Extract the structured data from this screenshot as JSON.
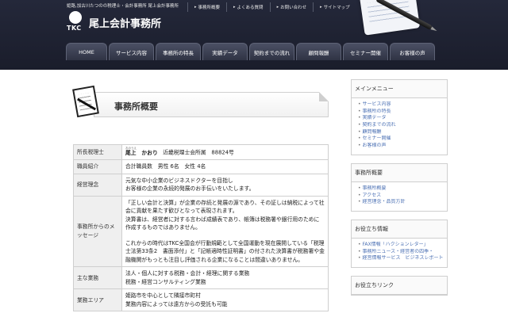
{
  "header": {
    "tagline": "姫路,加古川たつのの税理士・会計事務所 尾上会計事務所",
    "logo_mark": "TKC",
    "brand": "尾上会計事務所",
    "top_links": [
      "事務所概要",
      "よくある質問",
      "お問い合わせ",
      "サイトマップ"
    ]
  },
  "nav": {
    "tabs": [
      "HOME",
      "サービス内容",
      "事務所の特長",
      "実績データ",
      "契約までの流れ",
      "顧問報酬",
      "セミナー開催",
      "お客様の声"
    ]
  },
  "main": {
    "page_title": "事務所概要",
    "rows": [
      {
        "label": "所長税理士",
        "ruby": "おのうえ",
        "name": "尾上　かおり",
        "extra": "近畿税理士会所属　88824号"
      },
      {
        "label": "職員紹介",
        "lines": [
          "合計職員数　男性 6名　女性 4名"
        ]
      },
      {
        "label": "経営理念",
        "lines": [
          "元気な中小企業のビジネスドクターを目指し",
          "お客様の企業の永続的発展のお手伝いをいたします。"
        ]
      },
      {
        "label": "事務所からのメッセージ",
        "lines": [
          "「正しい会計と決算」が企業の存続と発展の源であり、その証しは納税によって社会に貢献を果たす歓びとなって表現されます。",
          "決算書は、経営者に対する言わば成績表であり、帳簿は税務署や銀行用のために作成するものではありません。",
          "",
          "これからの時代はTKC全国会が行動規範として全国運動を現在展開している「税理士法第33条2　書面添付」と「記帳適時性証明書」の付された決算書が税務署や金融機関がもっとも注目し評価される企業になることは間違いありません。"
        ]
      },
      {
        "label": "主な業務",
        "lines": [
          "法人・個人に対する税務・会計・経理に関する業務",
          "税務・経営コンサルティング業務"
        ]
      },
      {
        "label": "業務エリア",
        "lines": [
          "姫路市を中心として隣接市町村",
          "業務内容によっては遠方からの受託も可能"
        ]
      }
    ]
  },
  "sidebar": {
    "boxes": [
      {
        "title": "メインメニュー",
        "items": [
          "サービス内容",
          "事務所の特長",
          "実績データ",
          "契約までの流れ",
          "顧問報酬",
          "セミナー開催",
          "お客様の声"
        ]
      },
      {
        "title": "事務所概要",
        "items": [
          "事務所概要",
          "アクセス",
          "経営理念・品質方針"
        ]
      },
      {
        "title": "お役立ち情報",
        "items": [
          "FAX情報「ハクションレター」",
          "事務所ニュース・経営者の四季・",
          "経営情報サービス　ビジネスレポート"
        ]
      },
      {
        "title": "お役立ちリンク",
        "items": []
      }
    ]
  }
}
